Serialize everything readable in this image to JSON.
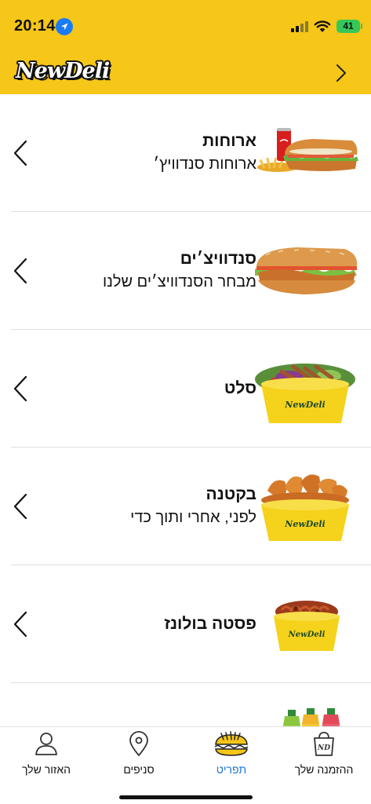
{
  "status_bar": {
    "time": "20:14",
    "battery": "41",
    "location_icon": "location-arrow-icon",
    "signal_icon": "cellular-signal-icon",
    "wifi_icon": "wifi-icon"
  },
  "header": {
    "logo_text": "NewDeli",
    "chevron_icon": "chevron-right-icon"
  },
  "menu": {
    "items": [
      {
        "title": "ארוחות",
        "subtitle": "ארוחות סנדוויץ׳",
        "image": "meal-sandwich-drink-fries-image"
      },
      {
        "title": "סנדוויצ׳ים",
        "subtitle": "מבחר הסנדוויצ׳ים שלנו",
        "image": "sandwich-image"
      },
      {
        "title": "סלט",
        "subtitle": "",
        "image": "salad-bowl-image"
      },
      {
        "title": "בקטנה",
        "subtitle": "לפני, אחרי ותוך כדי",
        "image": "chicken-wings-bowl-image"
      },
      {
        "title": "פסטה בולונז",
        "subtitle": "",
        "image": "pasta-bolognese-bowl-image"
      },
      {
        "title": "",
        "subtitle": "",
        "image": "drinks-bottles-image"
      }
    ]
  },
  "tab_bar": {
    "tabs": [
      {
        "label": "האזור שלך",
        "icon": "person-icon",
        "active": false
      },
      {
        "label": "סניפים",
        "icon": "map-pin-icon",
        "active": false
      },
      {
        "label": "תפריט",
        "icon": "sandwich-menu-icon",
        "active": true
      },
      {
        "label": "ההזמנה שלך",
        "icon": "shopping-bag-icon",
        "active": false
      }
    ]
  },
  "colors": {
    "brand_yellow": "#f6c618",
    "active_tab": "#1a72d8",
    "divider": "#dedede"
  }
}
